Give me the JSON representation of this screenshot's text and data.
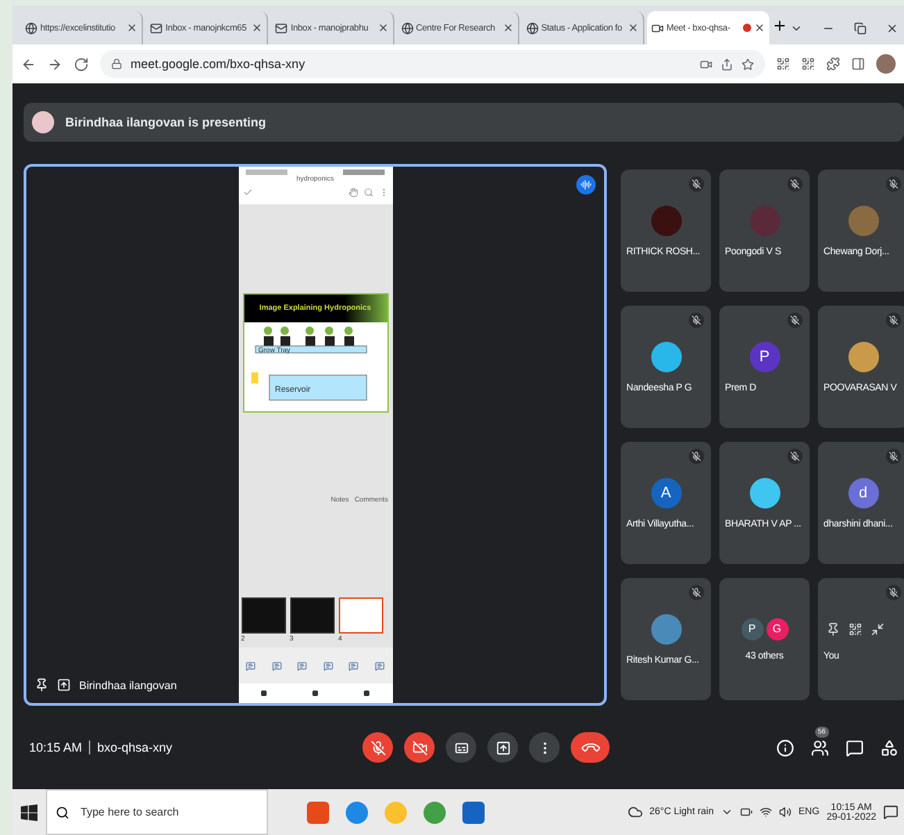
{
  "browser": {
    "tabs": [
      {
        "title": "https://excelinstitutio",
        "kind": "globe",
        "selected": false
      },
      {
        "title": "Inbox - manojnkcm65",
        "kind": "mail",
        "selected": false
      },
      {
        "title": "Inbox - manojprabhu",
        "kind": "mail",
        "selected": false
      },
      {
        "title": "Centre For Research",
        "kind": "globe",
        "selected": false
      },
      {
        "title": "Status - Application fo",
        "kind": "globe",
        "selected": false
      },
      {
        "title": "Meet - bxo-qhsa-",
        "kind": "meet",
        "selected": true,
        "recording": true
      }
    ],
    "url": "meet.google.com/bxo-qhsa-xny"
  },
  "banner": {
    "text": "Birindhaa ilangovan is presenting"
  },
  "presentation": {
    "presenter": "Birindhaa ilangovan",
    "doc_title": "hydroponics",
    "slide_title": "Image Explaining Hydroponics",
    "diagram_labels": [
      "Grow Tray",
      "Reservoir"
    ],
    "notes": "Notes",
    "comments": "Comments",
    "thumbnails": [
      {
        "number": "2",
        "selected": false
      },
      {
        "number": "3",
        "selected": false
      },
      {
        "number": "4",
        "selected": true
      }
    ]
  },
  "participants": [
    {
      "name": "RITHICK ROSH...",
      "kind": "photo",
      "color": "#3a1010",
      "muted": true
    },
    {
      "name": "Poongodi V S",
      "kind": "photo",
      "color": "#5a2a3a",
      "muted": true
    },
    {
      "name": "Chewang Dorj...",
      "kind": "photo",
      "color": "#8a6a40",
      "muted": true
    },
    {
      "name": "Nandeesha P G",
      "kind": "photo",
      "color": "#29b6e8",
      "muted": true
    },
    {
      "name": "Prem D",
      "kind": "letter",
      "letter": "P",
      "color": "#5b34c4",
      "muted": true
    },
    {
      "name": "POOVARASAN V",
      "kind": "photo",
      "color": "#c99a4a",
      "muted": true
    },
    {
      "name": "Arthi Villayutha...",
      "kind": "letter",
      "letter": "A",
      "color": "#1565c0",
      "muted": true
    },
    {
      "name": "BHARATH V AP ...",
      "kind": "photo",
      "color": "#3ec6f0",
      "muted": true
    },
    {
      "name": "dharshini dhani...",
      "kind": "letter",
      "letter": "d",
      "color": "#6a6fd6",
      "muted": true
    },
    {
      "name": "Ritesh Kumar G...",
      "kind": "photo",
      "color": "#4a8ab8",
      "muted": true
    },
    {
      "name": "43 others",
      "kind": "others",
      "avatars": [
        {
          "letter": "P",
          "color": "#455a64"
        },
        {
          "letter": "G",
          "color": "#e91e63"
        }
      ],
      "muted": false
    },
    {
      "name": "You",
      "kind": "self",
      "color": "#3c4043",
      "muted": true
    }
  ],
  "meeting": {
    "time": "10:15 AM",
    "code": "bxo-qhsa-xny",
    "people_count": "56"
  },
  "taskbar": {
    "search_placeholder": "Type here to search",
    "weather": "26°C  Light rain",
    "language": "ENG",
    "time": "10:15 AM",
    "date": "29-01-2022"
  }
}
